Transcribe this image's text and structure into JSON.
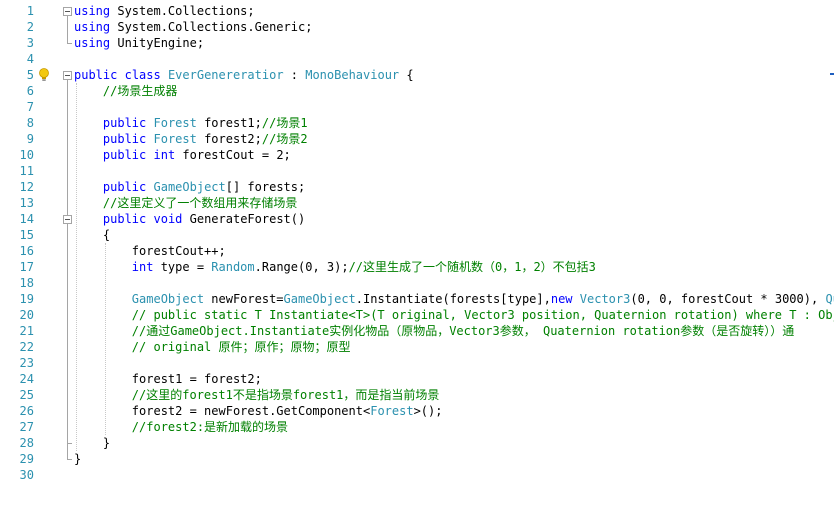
{
  "editor": {
    "line_numbers": [
      "1",
      "2",
      "3",
      "4",
      "5",
      "6",
      "7",
      "8",
      "9",
      "10",
      "11",
      "12",
      "13",
      "14",
      "15",
      "16",
      "17",
      "18",
      "19",
      "20",
      "21",
      "22",
      "23",
      "24",
      "25",
      "26",
      "27",
      "28",
      "29",
      "30"
    ],
    "lines": [
      [
        {
          "t": "kw",
          "v": "using"
        },
        {
          "t": "pl",
          "v": " System.Collections;"
        }
      ],
      [
        {
          "t": "kw",
          "v": "using"
        },
        {
          "t": "pl",
          "v": " System.Collections.Generic;"
        }
      ],
      [
        {
          "t": "kw",
          "v": "using"
        },
        {
          "t": "pl",
          "v": " UnityEngine;"
        }
      ],
      [],
      [
        {
          "t": "kw",
          "v": "public"
        },
        {
          "t": "pl",
          "v": " "
        },
        {
          "t": "kw",
          "v": "class"
        },
        {
          "t": "pl",
          "v": " "
        },
        {
          "t": "ty",
          "v": "EverGenereratior"
        },
        {
          "t": "pl",
          "v": " : "
        },
        {
          "t": "ty",
          "v": "MonoBehaviour"
        },
        {
          "t": "pl",
          "v": " {"
        }
      ],
      [
        {
          "t": "pl",
          "v": "    "
        },
        {
          "t": "cm",
          "v": "//场景生成器"
        }
      ],
      [],
      [
        {
          "t": "pl",
          "v": "    "
        },
        {
          "t": "kw",
          "v": "public"
        },
        {
          "t": "pl",
          "v": " "
        },
        {
          "t": "ty",
          "v": "Forest"
        },
        {
          "t": "pl",
          "v": " forest1;"
        },
        {
          "t": "cm",
          "v": "//场景1"
        }
      ],
      [
        {
          "t": "pl",
          "v": "    "
        },
        {
          "t": "kw",
          "v": "public"
        },
        {
          "t": "pl",
          "v": " "
        },
        {
          "t": "ty",
          "v": "Forest"
        },
        {
          "t": "pl",
          "v": " forest2;"
        },
        {
          "t": "cm",
          "v": "//场景2"
        }
      ],
      [
        {
          "t": "pl",
          "v": "    "
        },
        {
          "t": "kw",
          "v": "public"
        },
        {
          "t": "pl",
          "v": " "
        },
        {
          "t": "kw",
          "v": "int"
        },
        {
          "t": "pl",
          "v": " forestCout = 2;"
        }
      ],
      [],
      [
        {
          "t": "pl",
          "v": "    "
        },
        {
          "t": "kw",
          "v": "public"
        },
        {
          "t": "pl",
          "v": " "
        },
        {
          "t": "ty",
          "v": "GameObject"
        },
        {
          "t": "pl",
          "v": "[] forests;"
        }
      ],
      [
        {
          "t": "pl",
          "v": "    "
        },
        {
          "t": "cm",
          "v": "//这里定义了一个数组用来存储场景"
        }
      ],
      [
        {
          "t": "pl",
          "v": "    "
        },
        {
          "t": "kw",
          "v": "public"
        },
        {
          "t": "pl",
          "v": " "
        },
        {
          "t": "kw",
          "v": "void"
        },
        {
          "t": "pl",
          "v": " GenerateForest()"
        }
      ],
      [
        {
          "t": "pl",
          "v": "    {"
        }
      ],
      [
        {
          "t": "pl",
          "v": "        forestCout++;"
        }
      ],
      [
        {
          "t": "pl",
          "v": "        "
        },
        {
          "t": "kw",
          "v": "int"
        },
        {
          "t": "pl",
          "v": " type = "
        },
        {
          "t": "ty",
          "v": "Random"
        },
        {
          "t": "pl",
          "v": ".Range(0, 3);"
        },
        {
          "t": "cm",
          "v": "//这里生成了一个随机数（0，1，2）不包括3"
        }
      ],
      [],
      [
        {
          "t": "pl",
          "v": "        "
        },
        {
          "t": "ty",
          "v": "GameObject"
        },
        {
          "t": "pl",
          "v": " newForest="
        },
        {
          "t": "ty",
          "v": "GameObject"
        },
        {
          "t": "pl",
          "v": ".Instantiate(forests[type],"
        },
        {
          "t": "kw",
          "v": "new"
        },
        {
          "t": "pl",
          "v": " "
        },
        {
          "t": "ty",
          "v": "Vector3"
        },
        {
          "t": "pl",
          "v": "(0, 0, forestCout * 3000), "
        },
        {
          "t": "ty",
          "v": "Quat"
        }
      ],
      [
        {
          "t": "pl",
          "v": "        "
        },
        {
          "t": "cm",
          "v": "// public static T Instantiate<T>(T original, Vector3 position, Quaternion rotation) where T : Object"
        }
      ],
      [
        {
          "t": "pl",
          "v": "        "
        },
        {
          "t": "cm",
          "v": "//通过GameObject.Instantiate实例化物品（原物品，Vector3参数， Quaternion rotation参数（是否旋转））通"
        }
      ],
      [
        {
          "t": "pl",
          "v": "        "
        },
        {
          "t": "cm",
          "v": "// original 原件；原作；原物；原型"
        }
      ],
      [],
      [
        {
          "t": "pl",
          "v": "        forest1 = forest2;"
        }
      ],
      [
        {
          "t": "pl",
          "v": "        "
        },
        {
          "t": "cm",
          "v": "//这里的forest1不是指场景forest1，而是指当前场景"
        }
      ],
      [
        {
          "t": "pl",
          "v": "        forest2 = newForest.GetComponent<"
        },
        {
          "t": "ty",
          "v": "Forest"
        },
        {
          "t": "pl",
          "v": ">();"
        }
      ],
      [
        {
          "t": "pl",
          "v": "        "
        },
        {
          "t": "cm",
          "v": "//forest2:是新加载的场景"
        }
      ],
      [
        {
          "t": "pl",
          "v": "    }"
        }
      ],
      [
        {
          "t": "pl",
          "v": "}"
        }
      ],
      []
    ]
  },
  "colors": {
    "keyword": "#0000ff",
    "type": "#2b91af",
    "comment": "#008000",
    "line_number": "#2b91af",
    "lightbulb": "#f2c811"
  },
  "icons": {
    "lightbulb": "lightbulb-icon",
    "fold_toggle": "collapse-region-icon"
  }
}
